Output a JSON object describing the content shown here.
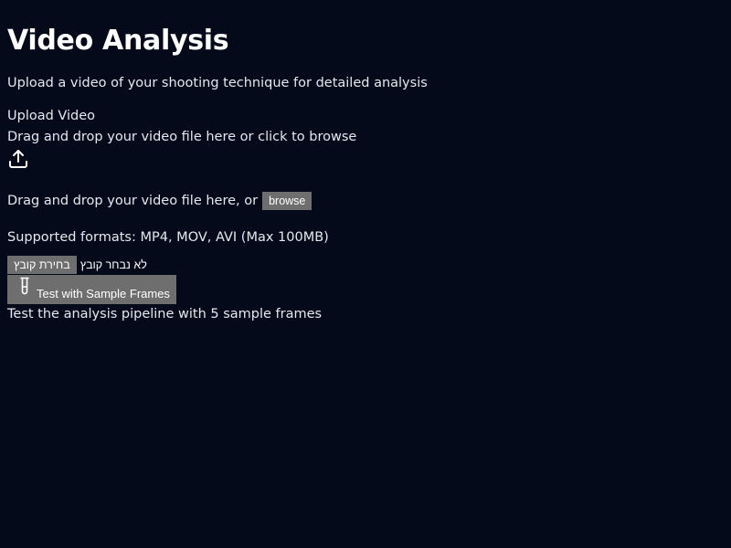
{
  "page": {
    "title": "Video Analysis",
    "subtitle": "Upload a video of your shooting technique for detailed analysis"
  },
  "upload": {
    "label": "Upload Video",
    "hint": "Drag and drop your video file here or click to browse",
    "icon": "upload-icon",
    "drop_text": "Drag and drop your video file here, or",
    "browse_label": "browse",
    "formats": "Supported formats: MP4, MOV, AVI (Max 100MB)"
  },
  "file_input": {
    "button_label": "בחירת קובץ",
    "status": "לא נבחר קובץ"
  },
  "sample": {
    "icon": "test-tube-icon",
    "button_label": "Test with Sample Frames",
    "hint": "Test the analysis pipeline with 5 sample frames"
  },
  "colors": {
    "background": "#050a1b",
    "text": "#e6e8ee",
    "button_bg": "#6e6e6e"
  }
}
